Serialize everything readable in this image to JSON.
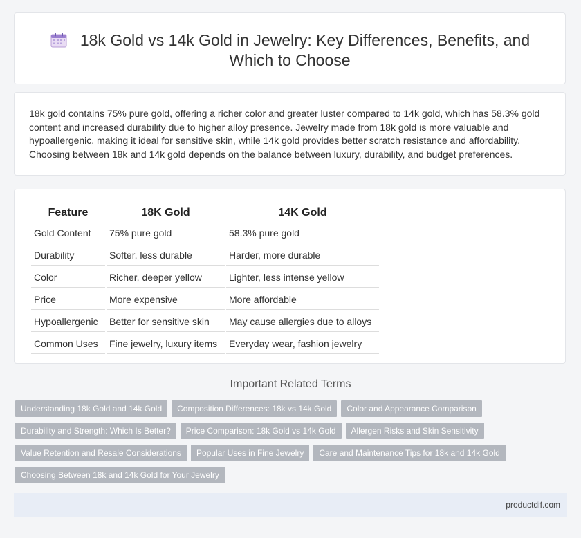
{
  "header": {
    "icon": "calendar-icon",
    "title": "18k Gold vs 14k Gold in Jewelry: Key Differences, Benefits, and Which to Choose"
  },
  "intro": {
    "text": "18k gold contains 75% pure gold, offering a richer color and greater luster compared to 14k gold, which has 58.3% gold content and increased durability due to higher alloy presence. Jewelry made from 18k gold is more valuable and hypoallergenic, making it ideal for sensitive skin, while 14k gold provides better scratch resistance and affordability. Choosing between 18k and 14k gold depends on the balance between luxury, durability, and budget preferences."
  },
  "table": {
    "headers": [
      "Feature",
      "18K Gold",
      "14K Gold"
    ],
    "rows": [
      [
        "Gold Content",
        "75% pure gold",
        "58.3% pure gold"
      ],
      [
        "Durability",
        "Softer, less durable",
        "Harder, more durable"
      ],
      [
        "Color",
        "Richer, deeper yellow",
        "Lighter, less intense yellow"
      ],
      [
        "Price",
        "More expensive",
        "More affordable"
      ],
      [
        "Hypoallergenic",
        "Better for sensitive skin",
        "May cause allergies due to alloys"
      ],
      [
        "Common Uses",
        "Fine jewelry, luxury items",
        "Everyday wear, fashion jewelry"
      ]
    ]
  },
  "related": {
    "title": "Important Related Terms",
    "tags": [
      "Understanding 18k Gold and 14k Gold",
      "Composition Differences: 18k vs 14k Gold",
      "Color and Appearance Comparison",
      "Durability and Strength: Which Is Better?",
      "Price Comparison: 18k Gold vs 14k Gold",
      "Allergen Risks and Skin Sensitivity",
      "Value Retention and Resale Considerations",
      "Popular Uses in Fine Jewelry",
      "Care and Maintenance Tips for 18k and 14k Gold",
      "Choosing Between 18k and 14k Gold for Your Jewelry"
    ]
  },
  "footer": {
    "site": "productdif.com"
  },
  "colors": {
    "tag_bg": "#b3b7be",
    "footer_bg": "#e8edf6",
    "page_bg": "#f4f5f7"
  }
}
